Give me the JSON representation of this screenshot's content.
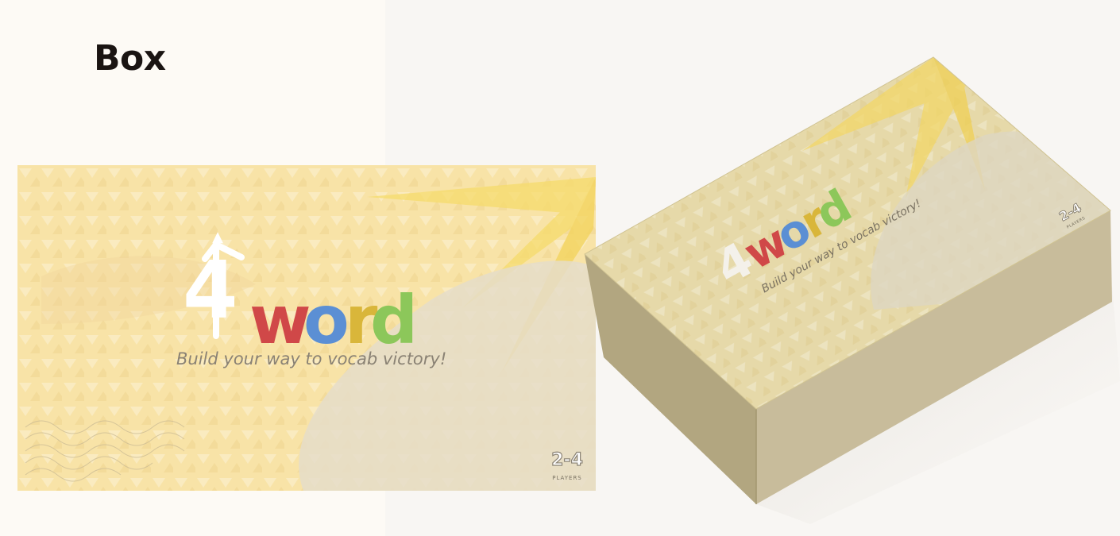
{
  "page": {
    "title": "Box"
  },
  "brand": {
    "logo_digit": "4",
    "logo_letters": [
      "w",
      "o",
      "r",
      "d"
    ],
    "tagline": "Build your way to vocab victory!",
    "players_count": "2-4",
    "players_label": "PLAYERS"
  },
  "colors": {
    "page_bg": "#fdfaf5",
    "art_bg": "#f8e3a7",
    "sunburst": "#f6dc6c",
    "blob": "#e5ddc9",
    "letter_w": "#d04848",
    "letter_o": "#5b8fd4",
    "letter_r": "#d9b63a",
    "letter_d": "#8cc75a",
    "digit": "#ffffff",
    "box_front": "#c8bc9b",
    "box_side": "#b2a680",
    "box_lid": "#e6d9a9"
  }
}
